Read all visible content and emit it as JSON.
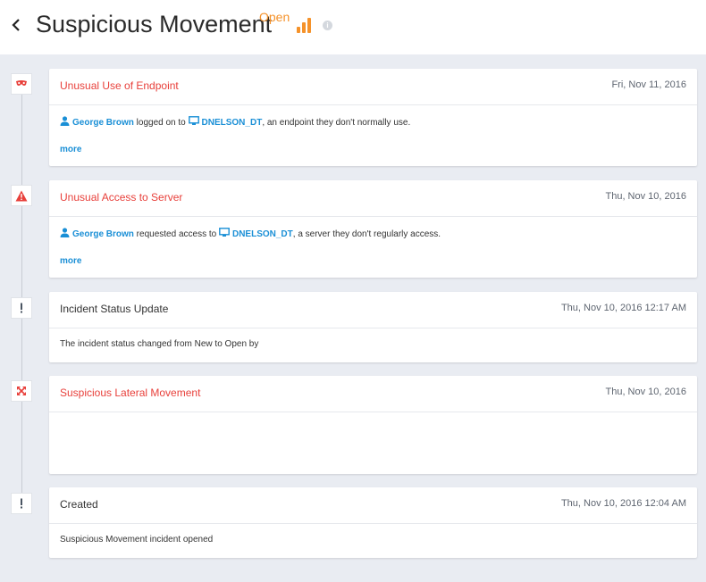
{
  "header": {
    "back_icon": "chevron-left-icon",
    "title": "Suspicious Movement",
    "status": "Open",
    "status_color": "#f5922a",
    "severity_icon": "signal-bars-icon",
    "info_icon": "info-icon"
  },
  "events": [
    {
      "icon": "mask-icon",
      "title": "Unusual Use of Endpoint",
      "date": "Fri, Nov 11, 2016",
      "user": "George Brown",
      "verb": " logged on to ",
      "host": "DNELSON_DT",
      "tail": ", an endpoint they don't normally use.",
      "more": "more"
    },
    {
      "icon": "warning-icon",
      "title": "Unusual Access to Server",
      "date": "Thu, Nov 10, 2016",
      "user": "George Brown",
      "verb": " requested access to ",
      "host": "DNELSON_DT",
      "tail": ", a server they don't regularly access.",
      "more": "more"
    },
    {
      "icon": "exclamation-icon",
      "title": "Incident Status Update",
      "date": "Thu, Nov 10, 2016 12:17 AM",
      "text": "The incident status changed from New to Open by"
    },
    {
      "icon": "lateral-movement-icon",
      "title": "Suspicious Lateral Movement",
      "date": "Thu, Nov 10, 2016"
    },
    {
      "icon": "exclamation-icon",
      "title": "Created",
      "date": "Thu, Nov 10, 2016 12:04 AM",
      "text": "Suspicious Movement incident opened"
    }
  ],
  "colors": {
    "alert": "#e8403b",
    "link": "#1a8fd6",
    "background": "#e9ecf2"
  }
}
